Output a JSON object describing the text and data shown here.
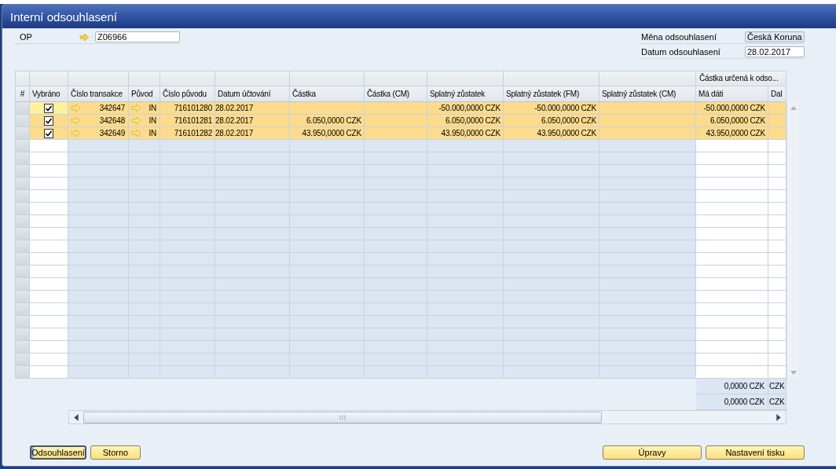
{
  "window": {
    "title": "Interní odsouhlasení"
  },
  "header": {
    "op_label": "OP",
    "op_value": "Z06966",
    "currency_label": "Měna odsouhlasení",
    "currency_value": "Česká Koruna",
    "date_label": "Datum odsouhlasení",
    "date_value": "28.02.2017"
  },
  "table": {
    "group_header": "Částka určená k odso...",
    "columns": [
      "#",
      "Vybráno",
      "Číslo transakce",
      "Původ",
      "Číslo původu",
      "Datum účtování",
      "Částka",
      "Částka (CM)",
      "Splatný zůstatek",
      "Splatný zůstatek (FM)",
      "Splatný zůstatek (CM)",
      "Má dáti",
      "Dal"
    ],
    "rows": [
      {
        "checked": true,
        "transaction": "342647",
        "origin": "IN",
        "origin_number": "716101280",
        "date": "28.02.2017",
        "amount": "",
        "amount_cm": "",
        "balance": "-50.000,0000  CZK",
        "balance_fm": "-50.000,0000  CZK",
        "balance_cm": "",
        "debit": "-50.000,0000 CZK",
        "credit": ""
      },
      {
        "checked": true,
        "transaction": "342648",
        "origin": "IN",
        "origin_number": "716101281",
        "date": "28.02.2017",
        "amount": "6.050,0000  CZK",
        "amount_cm": "",
        "balance": "6.050,0000  CZK",
        "balance_fm": "6.050,0000  CZK",
        "balance_cm": "",
        "debit": "6.050,0000 CZK",
        "credit": ""
      },
      {
        "checked": true,
        "transaction": "342649",
        "origin": "IN",
        "origin_number": "716101282",
        "date": "28.02.2017",
        "amount": "43.950,0000  CZK",
        "amount_cm": "",
        "balance": "43.950,0000  CZK",
        "balance_fm": "43.950,0000  CZK",
        "balance_cm": "",
        "debit": "43.950,0000 CZK",
        "credit": ""
      }
    ],
    "totals": [
      {
        "debit": "0,0000 CZK",
        "credit": "CZK"
      },
      {
        "debit": "0,0000 CZK",
        "credit": "CZK"
      }
    ]
  },
  "buttons_left": [
    {
      "label": "Odsouhlasení",
      "default": true
    },
    {
      "label": "Storno",
      "default": false
    }
  ],
  "buttons_right": [
    {
      "label": "Úpravy",
      "default": false
    },
    {
      "label": "Nastavení tisku",
      "default": false
    }
  ]
}
